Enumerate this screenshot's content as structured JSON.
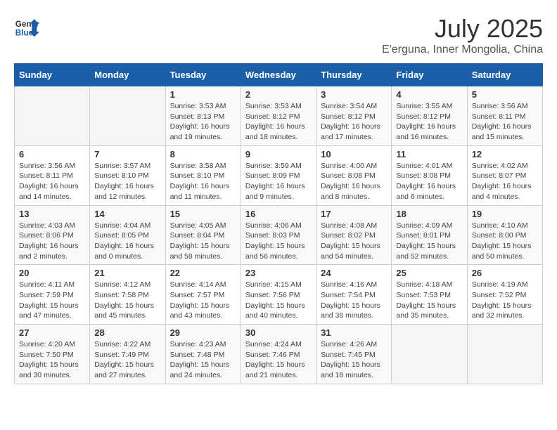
{
  "logo": {
    "general": "General",
    "blue": "Blue"
  },
  "title": {
    "month": "July 2025",
    "location": "E'erguna, Inner Mongolia, China"
  },
  "headers": [
    "Sunday",
    "Monday",
    "Tuesday",
    "Wednesday",
    "Thursday",
    "Friday",
    "Saturday"
  ],
  "weeks": [
    [
      {
        "day": "",
        "info": ""
      },
      {
        "day": "",
        "info": ""
      },
      {
        "day": "1",
        "info": "Sunrise: 3:53 AM\nSunset: 8:13 PM\nDaylight: 16 hours\nand 19 minutes."
      },
      {
        "day": "2",
        "info": "Sunrise: 3:53 AM\nSunset: 8:12 PM\nDaylight: 16 hours\nand 18 minutes."
      },
      {
        "day": "3",
        "info": "Sunrise: 3:54 AM\nSunset: 8:12 PM\nDaylight: 16 hours\nand 17 minutes."
      },
      {
        "day": "4",
        "info": "Sunrise: 3:55 AM\nSunset: 8:12 PM\nDaylight: 16 hours\nand 16 minutes."
      },
      {
        "day": "5",
        "info": "Sunrise: 3:56 AM\nSunset: 8:11 PM\nDaylight: 16 hours\nand 15 minutes."
      }
    ],
    [
      {
        "day": "6",
        "info": "Sunrise: 3:56 AM\nSunset: 8:11 PM\nDaylight: 16 hours\nand 14 minutes."
      },
      {
        "day": "7",
        "info": "Sunrise: 3:57 AM\nSunset: 8:10 PM\nDaylight: 16 hours\nand 12 minutes."
      },
      {
        "day": "8",
        "info": "Sunrise: 3:58 AM\nSunset: 8:10 PM\nDaylight: 16 hours\nand 11 minutes."
      },
      {
        "day": "9",
        "info": "Sunrise: 3:59 AM\nSunset: 8:09 PM\nDaylight: 16 hours\nand 9 minutes."
      },
      {
        "day": "10",
        "info": "Sunrise: 4:00 AM\nSunset: 8:08 PM\nDaylight: 16 hours\nand 8 minutes."
      },
      {
        "day": "11",
        "info": "Sunrise: 4:01 AM\nSunset: 8:08 PM\nDaylight: 16 hours\nand 6 minutes."
      },
      {
        "day": "12",
        "info": "Sunrise: 4:02 AM\nSunset: 8:07 PM\nDaylight: 16 hours\nand 4 minutes."
      }
    ],
    [
      {
        "day": "13",
        "info": "Sunrise: 4:03 AM\nSunset: 8:06 PM\nDaylight: 16 hours\nand 2 minutes."
      },
      {
        "day": "14",
        "info": "Sunrise: 4:04 AM\nSunset: 8:05 PM\nDaylight: 16 hours\nand 0 minutes."
      },
      {
        "day": "15",
        "info": "Sunrise: 4:05 AM\nSunset: 8:04 PM\nDaylight: 15 hours\nand 58 minutes."
      },
      {
        "day": "16",
        "info": "Sunrise: 4:06 AM\nSunset: 8:03 PM\nDaylight: 15 hours\nand 56 minutes."
      },
      {
        "day": "17",
        "info": "Sunrise: 4:08 AM\nSunset: 8:02 PM\nDaylight: 15 hours\nand 54 minutes."
      },
      {
        "day": "18",
        "info": "Sunrise: 4:09 AM\nSunset: 8:01 PM\nDaylight: 15 hours\nand 52 minutes."
      },
      {
        "day": "19",
        "info": "Sunrise: 4:10 AM\nSunset: 8:00 PM\nDaylight: 15 hours\nand 50 minutes."
      }
    ],
    [
      {
        "day": "20",
        "info": "Sunrise: 4:11 AM\nSunset: 7:59 PM\nDaylight: 15 hours\nand 47 minutes."
      },
      {
        "day": "21",
        "info": "Sunrise: 4:12 AM\nSunset: 7:58 PM\nDaylight: 15 hours\nand 45 minutes."
      },
      {
        "day": "22",
        "info": "Sunrise: 4:14 AM\nSunset: 7:57 PM\nDaylight: 15 hours\nand 43 minutes."
      },
      {
        "day": "23",
        "info": "Sunrise: 4:15 AM\nSunset: 7:56 PM\nDaylight: 15 hours\nand 40 minutes."
      },
      {
        "day": "24",
        "info": "Sunrise: 4:16 AM\nSunset: 7:54 PM\nDaylight: 15 hours\nand 38 minutes."
      },
      {
        "day": "25",
        "info": "Sunrise: 4:18 AM\nSunset: 7:53 PM\nDaylight: 15 hours\nand 35 minutes."
      },
      {
        "day": "26",
        "info": "Sunrise: 4:19 AM\nSunset: 7:52 PM\nDaylight: 15 hours\nand 32 minutes."
      }
    ],
    [
      {
        "day": "27",
        "info": "Sunrise: 4:20 AM\nSunset: 7:50 PM\nDaylight: 15 hours\nand 30 minutes."
      },
      {
        "day": "28",
        "info": "Sunrise: 4:22 AM\nSunset: 7:49 PM\nDaylight: 15 hours\nand 27 minutes."
      },
      {
        "day": "29",
        "info": "Sunrise: 4:23 AM\nSunset: 7:48 PM\nDaylight: 15 hours\nand 24 minutes."
      },
      {
        "day": "30",
        "info": "Sunrise: 4:24 AM\nSunset: 7:46 PM\nDaylight: 15 hours\nand 21 minutes."
      },
      {
        "day": "31",
        "info": "Sunrise: 4:26 AM\nSunset: 7:45 PM\nDaylight: 15 hours\nand 18 minutes."
      },
      {
        "day": "",
        "info": ""
      },
      {
        "day": "",
        "info": ""
      }
    ]
  ]
}
